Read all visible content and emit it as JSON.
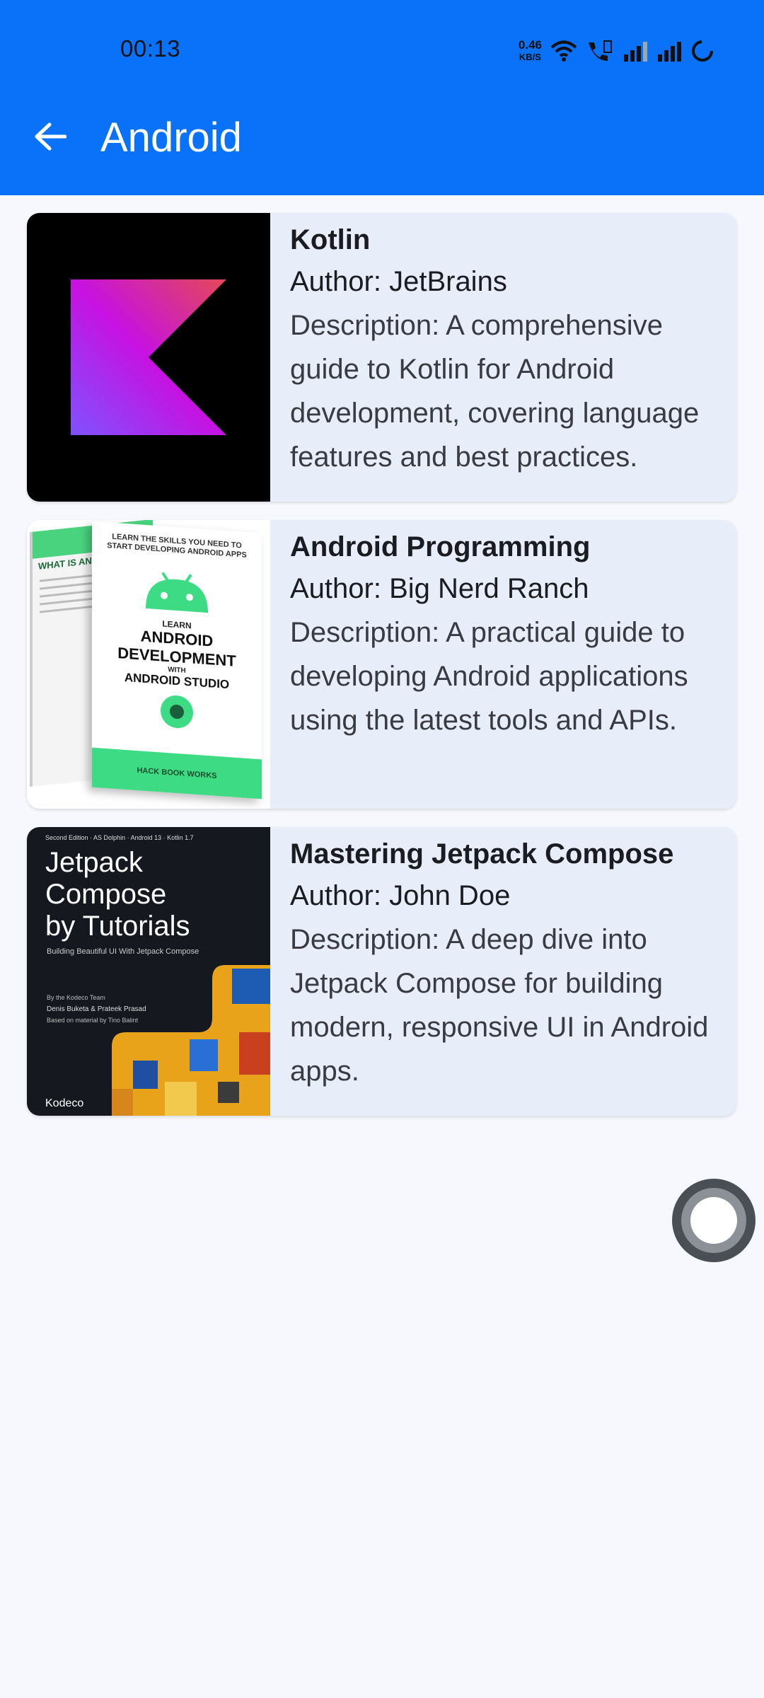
{
  "status_bar": {
    "time": "00:13",
    "net_speed_value": "0.46",
    "net_speed_unit": "KB/S",
    "icons": [
      "wifi-icon",
      "volte-call-icon",
      "signal-icon",
      "signal-icon",
      "loading-icon"
    ]
  },
  "app_bar": {
    "back_icon": "arrow-left-icon",
    "title": "Android",
    "color": "#0a72f8"
  },
  "books": [
    {
      "title": "Kotlin",
      "author": "Author: JetBrains",
      "description": "Description: A comprehensive guide to Kotlin for Android development, covering language features and best practices.",
      "image": "kotlin-logo"
    },
    {
      "title": "Android Programming",
      "author": "Author: Big Nerd Ranch",
      "description": "Description: A practical guide to developing Android applications using the latest tools and APIs.",
      "image": "android-development-book-cover",
      "cover": {
        "top_text": "LEARN THE SKILLS YOU NEED TO START DEVELOPING ANDROID APPS",
        "learn": "LEARN",
        "line1": "ANDROID",
        "line2": "DEVELOPMENT",
        "with": "WITH",
        "line3": "ANDROID STUDIO",
        "publisher": "HACK BOOK WORKS",
        "back_title": "WHAT IS AN"
      }
    },
    {
      "title": "Mastering Jetpack Compose",
      "author": "Author: John Doe",
      "description": "Description: A deep dive into Jetpack Compose for building modern, responsive UI in Android apps.",
      "image": "jetpack-compose-tutorials-cover",
      "cover": {
        "edition": "Second Edition · AS Dolphin · Android 13 · Kotlin 1.7",
        "line1": "Jetpack",
        "line2": "Compose",
        "line3": "by Tutorials",
        "subtitle": "Building Beautiful UI With Jetpack Compose",
        "team": "By the Kodeco Team",
        "authors": "Denis Buketa & Prateek Prasad",
        "based": "Based on material by Tino Balint",
        "publisher": "Kodeco"
      }
    }
  ],
  "fab_icon": "assistive-touch-icon"
}
